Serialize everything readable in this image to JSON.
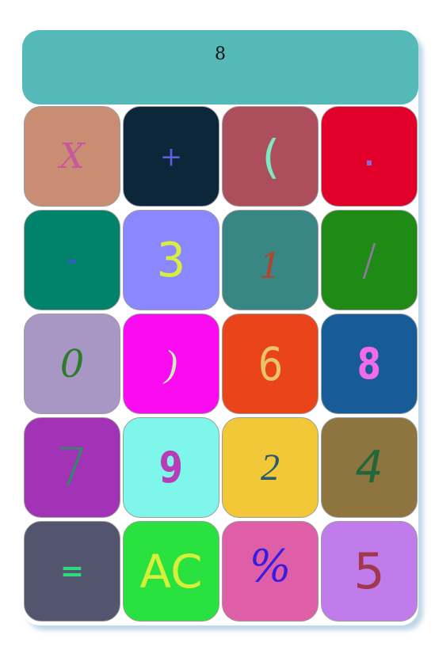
{
  "display": {
    "value": "8"
  },
  "keys": [
    {
      "label": "X",
      "bg": "#c98d74",
      "color": "#c7589e"
    },
    {
      "label": "+",
      "bg": "#0c263a",
      "color": "#5f5de0"
    },
    {
      "label": "(",
      "bg": "#ad4e5c",
      "color": "#7ee8c0"
    },
    {
      "label": ".",
      "bg": "#e0002a",
      "color": "#8a68d8"
    },
    {
      "label": "-",
      "bg": "#00836a",
      "color": "#2b63b8"
    },
    {
      "label": "3",
      "bg": "#8a87ff",
      "color": "#d7ee40"
    },
    {
      "label": "1",
      "bg": "#388785",
      "color": "#b5432c"
    },
    {
      "label": "/",
      "bg": "#1f8a16",
      "color": "#8e7a9a"
    },
    {
      "label": "0",
      "bg": "#a896c5",
      "color": "#2f7a2c"
    },
    {
      "label": ")",
      "bg": "#fa0bf0",
      "color": "#c8f0b8"
    },
    {
      "label": "6",
      "bg": "#ea441a",
      "color": "#e9c56a"
    },
    {
      "label": "8",
      "bg": "#175c99",
      "color": "#f26be8"
    },
    {
      "label": "7",
      "bg": "#a233b6",
      "color": "#2f8a68"
    },
    {
      "label": "9",
      "bg": "#7ff6ea",
      "color": "#b83cb6"
    },
    {
      "label": "2",
      "bg": "#f2c838",
      "color": "#2b5a6a"
    },
    {
      "label": "4",
      "bg": "#8e7540",
      "color": "#22663a"
    },
    {
      "label": "=",
      "bg": "#53546e",
      "color": "#2ddc7a"
    },
    {
      "label": "AC",
      "bg": "#29e23f",
      "color": "#d7ee3a"
    },
    {
      "label": "%",
      "bg": "#de5fa8",
      "color": "#3a1ce0"
    },
    {
      "label": "5",
      "bg": "#c07cea",
      "color": "#a23850"
    }
  ]
}
